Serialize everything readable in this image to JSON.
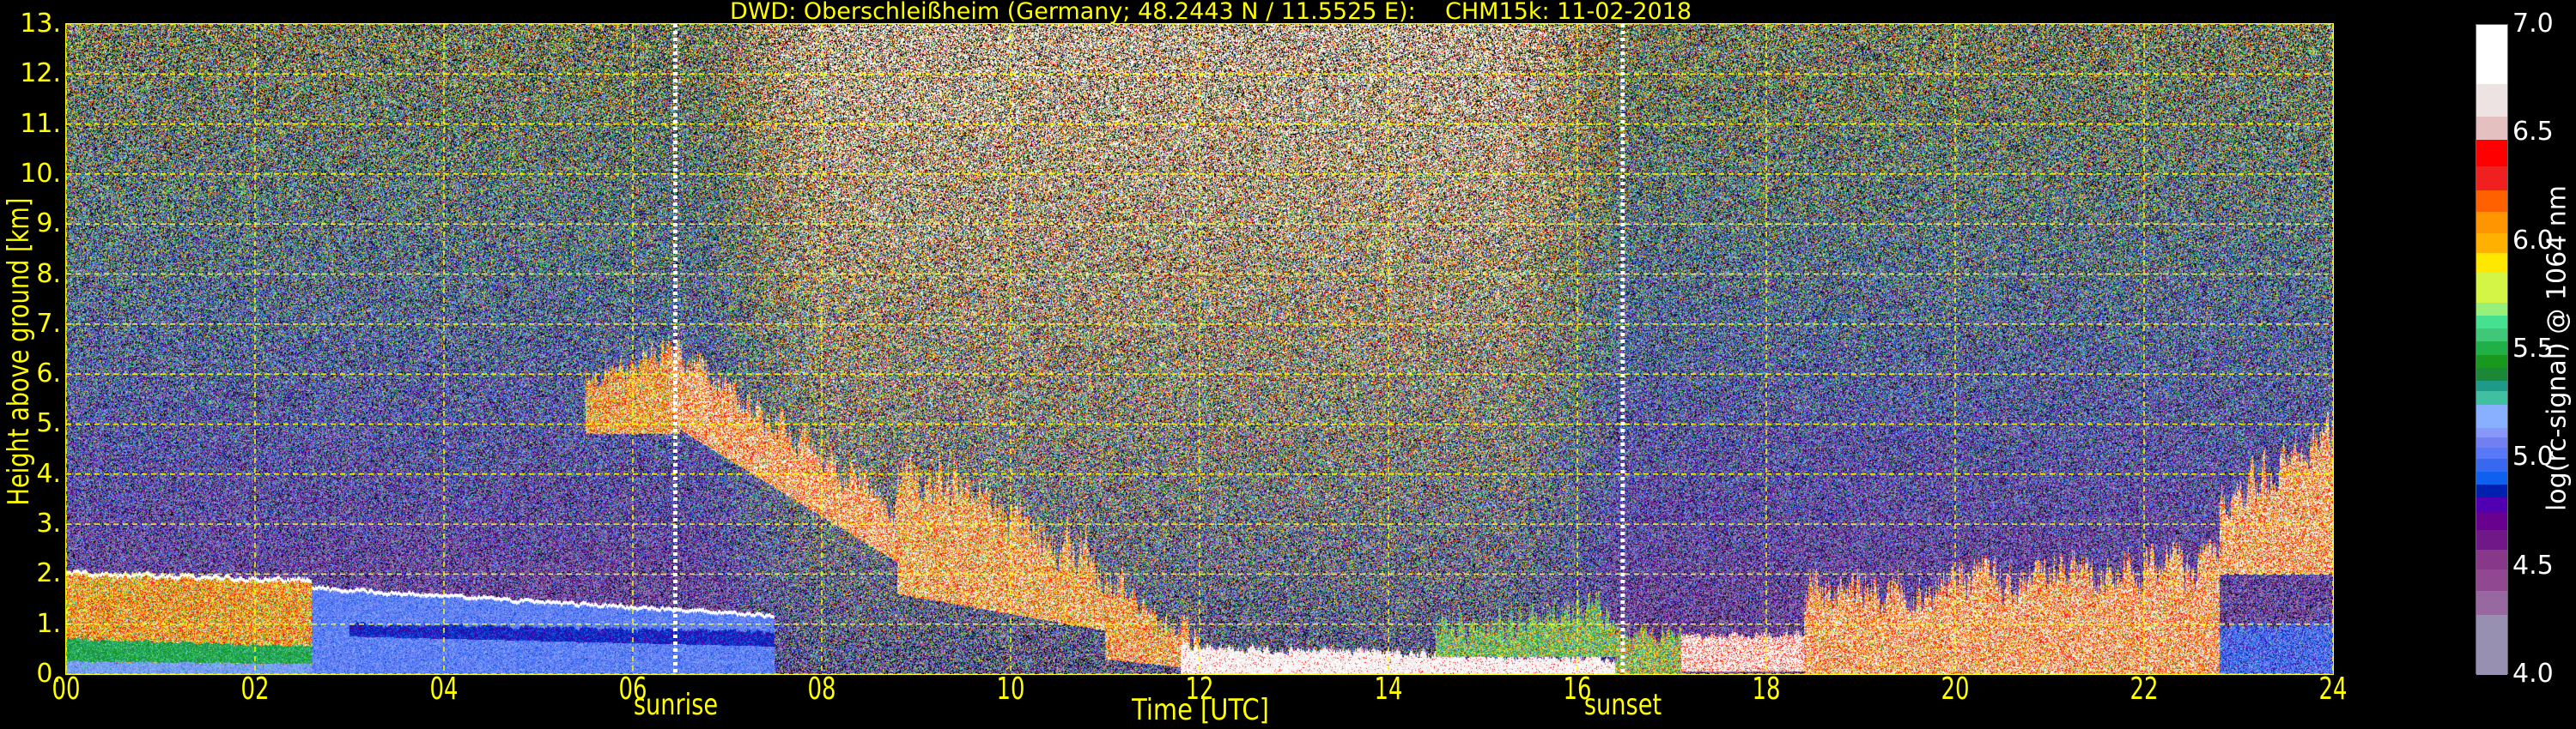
{
  "chart_data": {
    "type": "heatmap",
    "title": "DWD: Oberschleißheim (Germany; 48.2443 N / 11.5525 E):    CHM15k: 11-02-2018",
    "xlabel": "Time [UTC]",
    "ylabel": "Height above ground [km]",
    "xlim": [
      0,
      24
    ],
    "ylim": [
      0,
      13
    ],
    "x_ticks": [
      0,
      2,
      4,
      6,
      8,
      10,
      12,
      14,
      16,
      18,
      20,
      22,
      24
    ],
    "x_tick_labels": [
      "00",
      "02",
      "04",
      "06",
      "08",
      "10",
      "12",
      "14",
      "16",
      "18",
      "20",
      "22",
      "24"
    ],
    "y_ticks": [
      0,
      1,
      2,
      3,
      4,
      5,
      6,
      7,
      8,
      9,
      10,
      11,
      12,
      13
    ],
    "y_tick_labels": [
      "0.",
      "1.",
      "2.",
      "3.",
      "4.",
      "5.",
      "6.",
      "7.",
      "8.",
      "9.",
      "10.",
      "11.",
      "12.",
      "13."
    ],
    "grid": true,
    "grid_color": "#ffff00",
    "annotations": [
      {
        "label": "sunrise",
        "time": 6.45
      },
      {
        "label": "sunset",
        "time": 16.48
      }
    ],
    "colorbar": {
      "label": "log(rc-signal) @ 1064 nm",
      "range": [
        4.0,
        7.0
      ],
      "ticks": [
        4.0,
        4.5,
        5.0,
        5.5,
        6.0,
        6.5,
        7.0
      ],
      "tick_labels": [
        "4.0",
        "4.5",
        "5.0",
        "5.5",
        "6.0",
        "6.5",
        "7.0"
      ],
      "bins": [
        {
          "from": 4.0,
          "color": "#9890b0"
        },
        {
          "from": 4.28,
          "color": "#9868a0"
        },
        {
          "from": 4.39,
          "color": "#904890"
        },
        {
          "from": 4.49,
          "color": "#883888"
        },
        {
          "from": 4.58,
          "color": "#701888"
        },
        {
          "from": 4.67,
          "color": "#680090"
        },
        {
          "from": 4.75,
          "color": "#5000b0"
        },
        {
          "from": 4.82,
          "color": "#0020b0"
        },
        {
          "from": 4.88,
          "color": "#1060f0"
        },
        {
          "from": 4.94,
          "color": "#3868f0"
        },
        {
          "from": 5.0,
          "color": "#5878f8"
        },
        {
          "from": 5.05,
          "color": "#7080f0"
        },
        {
          "from": 5.1,
          "color": "#8898f8"
        },
        {
          "from": 5.14,
          "color": "#88b0ff"
        },
        {
          "from": 5.25,
          "color": "#40c0a0"
        },
        {
          "from": 5.31,
          "color": "#209a88"
        },
        {
          "from": 5.36,
          "color": "#1b8838"
        },
        {
          "from": 5.42,
          "color": "#18981c"
        },
        {
          "from": 5.48,
          "color": "#20b048"
        },
        {
          "from": 5.54,
          "color": "#40c878"
        },
        {
          "from": 5.6,
          "color": "#45e090"
        },
        {
          "from": 5.66,
          "color": "#98f07a"
        },
        {
          "from": 5.72,
          "color": "#d4f545"
        },
        {
          "from": 5.86,
          "color": "#ffe800"
        },
        {
          "from": 5.95,
          "color": "#ffb000"
        },
        {
          "from": 6.04,
          "color": "#ff9500"
        },
        {
          "from": 6.14,
          "color": "#ff6000"
        },
        {
          "from": 6.24,
          "color": "#f02020"
        },
        {
          "from": 6.35,
          "color": "#ff0000"
        },
        {
          "from": 6.47,
          "color": "#e5c0c0"
        },
        {
          "from": 6.58,
          "color": "#ede3e3"
        },
        {
          "from": 6.73,
          "color": "#ffffff"
        }
      ]
    },
    "features": [
      {
        "name": "night-boundary-layer",
        "t": [
          0,
          2.6
        ],
        "bottom": [
          0,
          0
        ],
        "top": [
          2.05,
          1.9
        ],
        "value": 6.1,
        "sd": 0.35,
        "jit": 0.05,
        "cap": true
      },
      {
        "name": "night-lower-layer",
        "t": [
          0,
          2.6
        ],
        "bottom": [
          0.25,
          0.2
        ],
        "top": [
          0.7,
          0.55
        ],
        "value": 5.45,
        "sd": 0.1,
        "jit": 0.03
      },
      {
        "name": "night-surface-layer",
        "t": [
          0,
          2.6
        ],
        "bottom": [
          0,
          0
        ],
        "top": [
          0.25,
          0.2
        ],
        "value": 5.15,
        "sd": 0.08,
        "jit": 0.02
      },
      {
        "name": "residual-layer",
        "t": [
          2.6,
          7.5
        ],
        "bottom": [
          0,
          0
        ],
        "top": [
          1.75,
          1.2
        ],
        "value": 5.05,
        "sd": 0.08,
        "jit": 0.04,
        "cap": true
      },
      {
        "name": "purple-band",
        "t": [
          3,
          7.5
        ],
        "bottom": [
          0.75,
          0.55
        ],
        "top": [
          1.0,
          0.85
        ],
        "value": 4.85,
        "sd": 0.05,
        "jit": 0.05
      },
      {
        "name": "morning-cloud",
        "t": [
          5.5,
          6.5
        ],
        "bottom": [
          4.8,
          4.8
        ],
        "top": [
          5.8,
          6.6
        ],
        "value": 6.2,
        "sd": 0.4,
        "jit": 0.3
      },
      {
        "name": "descending-cloud",
        "t": [
          6.4,
          9.0
        ],
        "bottom": [
          5.0,
          2.0
        ],
        "top": [
          6.5,
          3.0
        ],
        "value": 6.4,
        "sd": 0.4,
        "jit": 0.4
      },
      {
        "name": "midday-cloud",
        "t": [
          8.8,
          11.2
        ],
        "bottom": [
          1.6,
          0.8
        ],
        "top": [
          4.3,
          2.0
        ],
        "value": 6.3,
        "sd": 0.45,
        "jit": 0.6
      },
      {
        "name": "late-morning-cloud",
        "t": [
          11,
          12
        ],
        "bottom": [
          0.3,
          0.1
        ],
        "top": [
          1.8,
          0.7
        ],
        "value": 6.3,
        "sd": 0.4,
        "jit": 0.3
      },
      {
        "name": "afternoon-fog",
        "t": [
          11.8,
          16.4
        ],
        "bottom": [
          0,
          0
        ],
        "top": [
          0.55,
          0.3
        ],
        "value": 6.8,
        "sd": 0.2,
        "jit": 0.1
      },
      {
        "name": "afternoon-aerosol",
        "t": [
          14.5,
          16.4
        ],
        "bottom": [
          0.35,
          0.35
        ],
        "top": [
          0.9,
          1.3
        ],
        "value": 5.6,
        "sd": 0.35,
        "jit": 0.4
      },
      {
        "name": "dusk-layer",
        "t": [
          16.4,
          17.1
        ],
        "bottom": [
          0,
          0
        ],
        "top": [
          0.8,
          0.8
        ],
        "value": 5.7,
        "sd": 0.4,
        "jit": 0.2
      },
      {
        "name": "evening-fog",
        "t": [
          17.1,
          18.4
        ],
        "bottom": [
          0.05,
          0.05
        ],
        "top": [
          0.75,
          0.8
        ],
        "value": 6.7,
        "sd": 0.3,
        "jit": 0.1
      },
      {
        "name": "evening-cloud",
        "t": [
          18.4,
          22.8
        ],
        "bottom": [
          0,
          0
        ],
        "top": [
          1.6,
          2.2
        ],
        "value": 6.4,
        "sd": 0.4,
        "jit": 0.5
      },
      {
        "name": "late-elevated-cloud",
        "t": [
          22.8,
          24
        ],
        "bottom": [
          2.0,
          2.0
        ],
        "top": [
          3.5,
          4.8
        ],
        "value": 6.4,
        "sd": 0.4,
        "jit": 0.5
      },
      {
        "name": "late-surface-layer",
        "t": [
          22.8,
          24
        ],
        "bottom": [
          0,
          0
        ],
        "top": [
          1.0,
          1.0
        ],
        "value": 5.0,
        "sd": 0.15,
        "jit": 0.1
      }
    ]
  }
}
